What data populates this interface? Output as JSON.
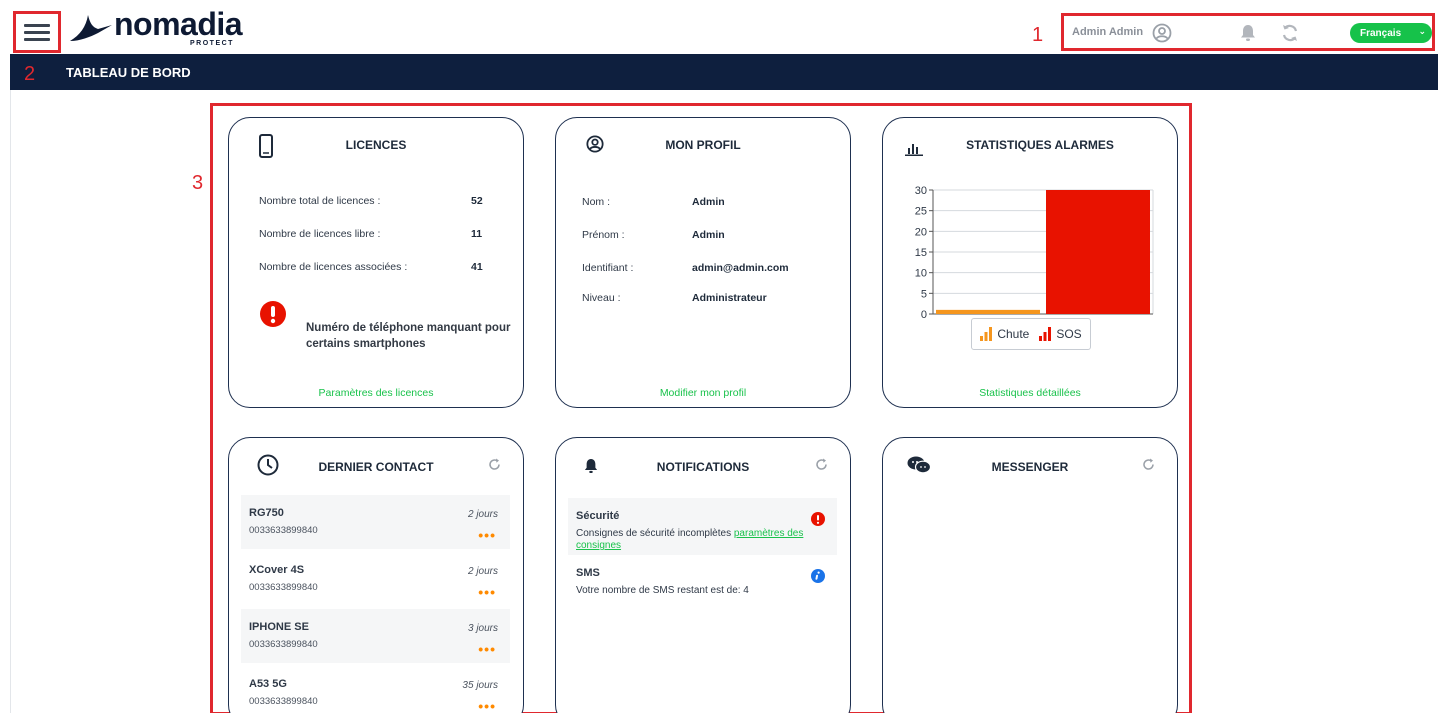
{
  "header": {
    "logo_text": "nomadia",
    "logo_sub": "PROTECT",
    "user_name": "Admin Admin",
    "language": "Français",
    "annotation_1": "1",
    "annotation_2": "2",
    "annotation_3": "3"
  },
  "navbar": {
    "title": "TABLEAU DE BORD"
  },
  "licences": {
    "title": "LICENCES",
    "rows": [
      {
        "label": "Nombre total de licences :",
        "value": "52"
      },
      {
        "label": "Nombre de licences libre :",
        "value": "11"
      },
      {
        "label": "Nombre de licences associées :",
        "value": "41"
      }
    ],
    "alert": "Numéro de téléphone manquant pour certains smartphones",
    "link": "Paramètres des licences"
  },
  "profil": {
    "title": "MON PROFIL",
    "rows": [
      {
        "label": "Nom :",
        "value": "Admin"
      },
      {
        "label": "Prénom :",
        "value": "Admin"
      },
      {
        "label": "Identifiant :",
        "value": "admin@admin.com"
      },
      {
        "label": "Niveau :",
        "value": "Administrateur"
      }
    ],
    "link": "Modifier mon profil"
  },
  "stats": {
    "title": "STATISTIQUES ALARMES",
    "link": "Statistiques détaillées"
  },
  "chart_data": {
    "type": "bar",
    "categories": [
      "Chute",
      "SOS"
    ],
    "series": [
      {
        "name": "Chute",
        "values": [
          1
        ]
      },
      {
        "name": "SOS",
        "values": [
          30
        ]
      }
    ],
    "ylim": [
      0,
      30
    ],
    "yticks": [
      "0",
      "5",
      "10",
      "15",
      "20",
      "25",
      "30"
    ],
    "colors": {
      "Chute": "#f5961e",
      "SOS": "#e81200"
    },
    "legend": "bottom"
  },
  "contact": {
    "title": "DERNIER CONTACT",
    "items": [
      {
        "name": "RG750",
        "number": "0033633899840",
        "time": "2 jours"
      },
      {
        "name": "XCover 4S",
        "number": "0033633899840",
        "time": "2 jours"
      },
      {
        "name": "IPHONE SE",
        "number": "0033633899840",
        "time": "3 jours"
      },
      {
        "name": "A53 5G",
        "number": "0033633899840",
        "time": "35 jours"
      }
    ],
    "dots": "•••"
  },
  "notifications": {
    "title": "NOTIFICATIONS",
    "items": [
      {
        "title": "Sécurité",
        "body": "Consignes de sécurité incomplètes ",
        "link": "paramètres des consignes",
        "icon": "error-icon"
      },
      {
        "title": "SMS",
        "body": "Votre nombre de SMS restant est de: 4",
        "link": "",
        "icon": "info-icon"
      }
    ]
  },
  "messenger": {
    "title": "MESSENGER"
  },
  "colors": {
    "green": "#19c24b",
    "navy": "#0e1f3e",
    "red": "#e0282e",
    "orange": "#ff8a00"
  }
}
